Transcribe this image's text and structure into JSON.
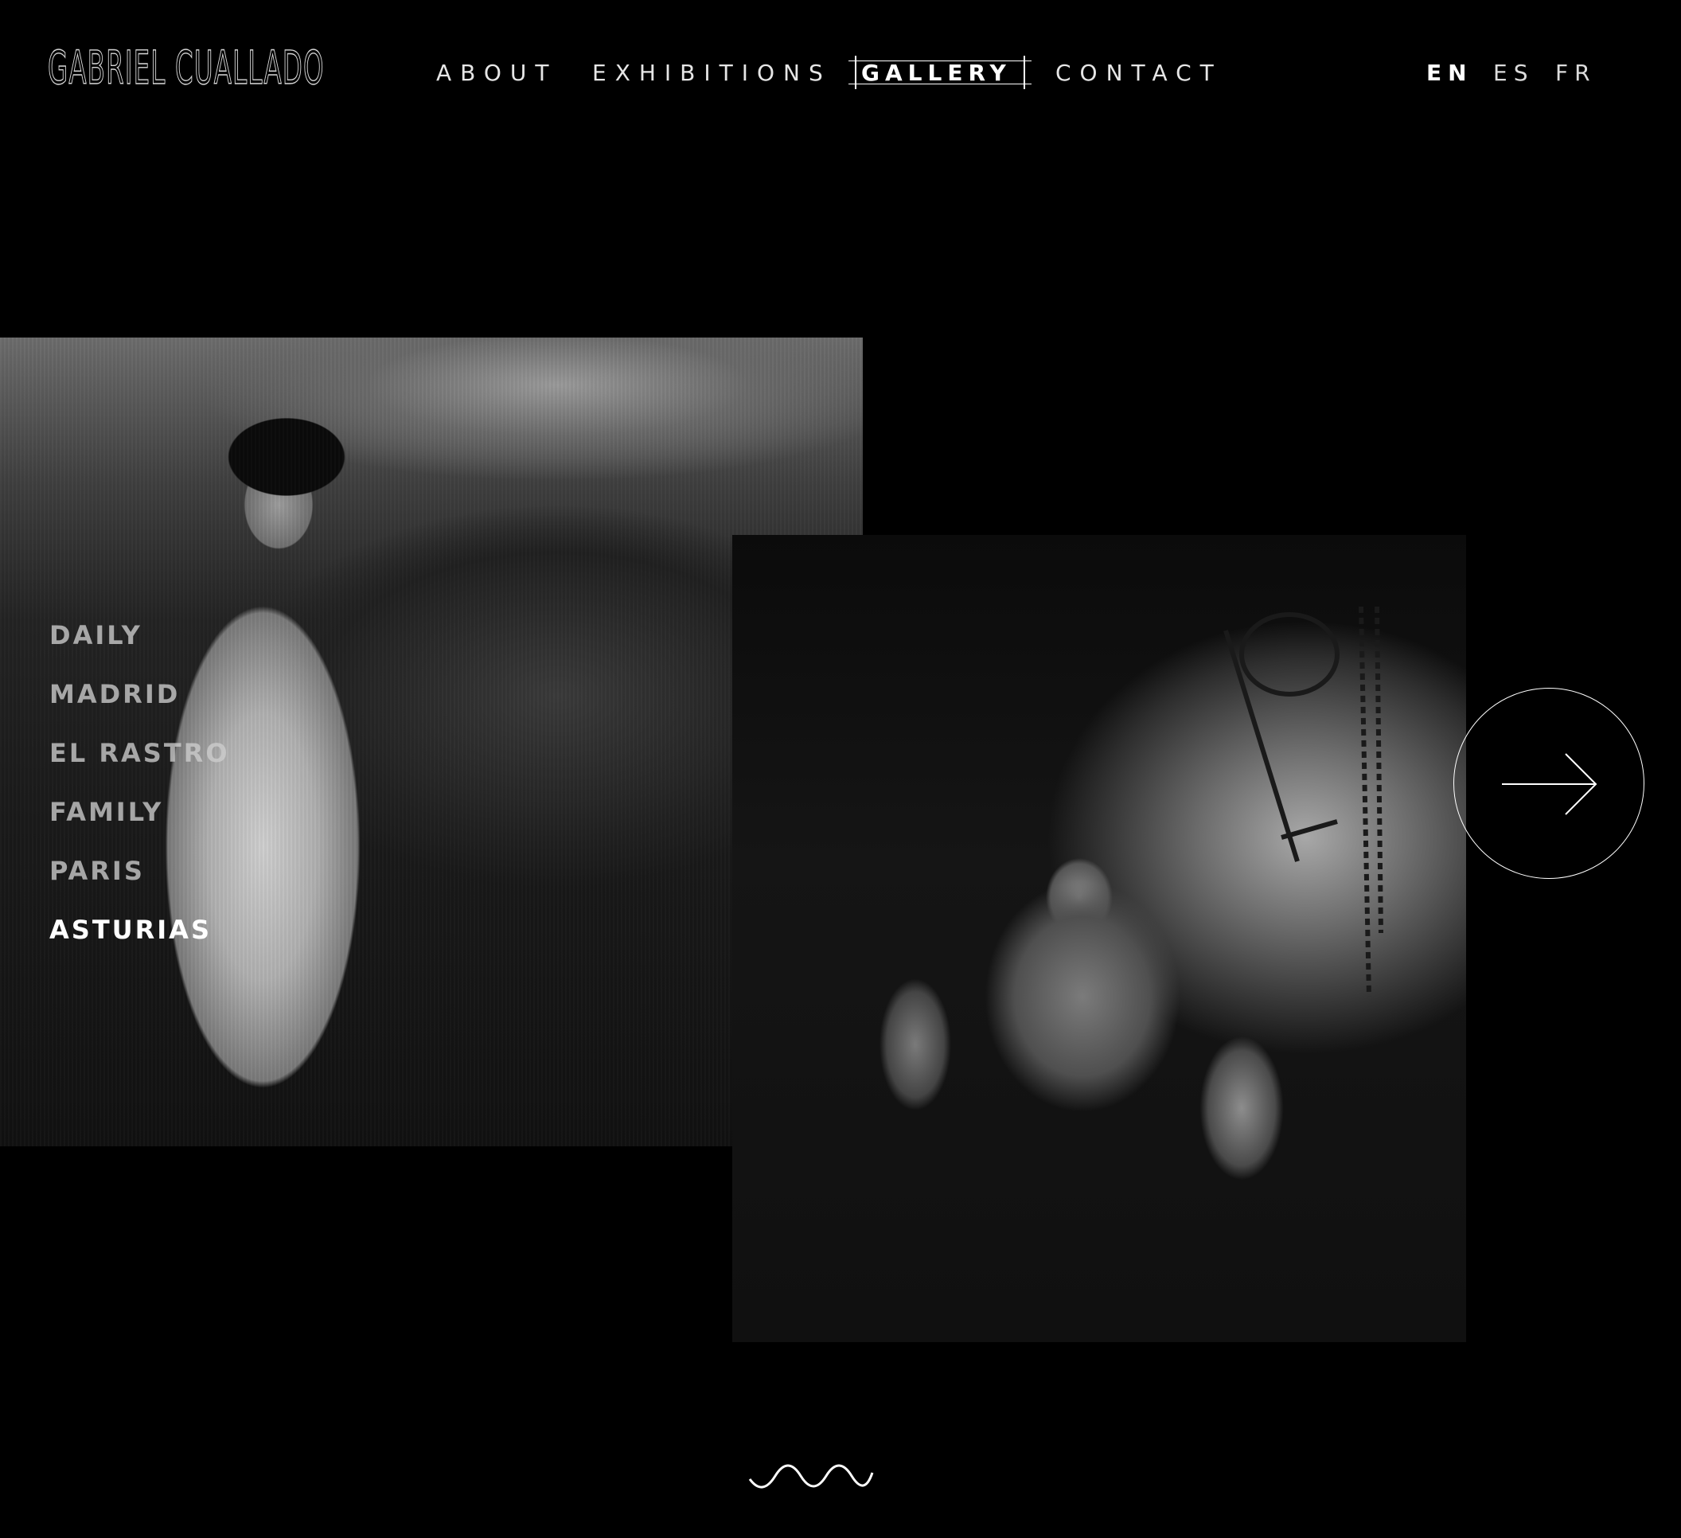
{
  "header": {
    "logo": "GABRIEL CUALLADO",
    "nav": [
      {
        "label": "ABOUT"
      },
      {
        "label": "EXHIBITIONS"
      },
      {
        "label": "GALLERY"
      },
      {
        "label": "CONTACT"
      }
    ],
    "active_nav": "GALLERY",
    "languages": [
      "EN",
      "ES",
      "FR"
    ],
    "active_language": "EN"
  },
  "gallery": {
    "categories": [
      "DAILY",
      "MADRID",
      "EL RASTRO",
      "FAMILY",
      "PARIS",
      "ASTURIAS"
    ],
    "active_category": "ASTURIAS",
    "next_icon": "arrow-right-icon",
    "scroll_icon": "wave-icon"
  },
  "colors": {
    "background": "#000000",
    "text": "#ffffff",
    "inactive_menu": "#cdcdcd"
  }
}
